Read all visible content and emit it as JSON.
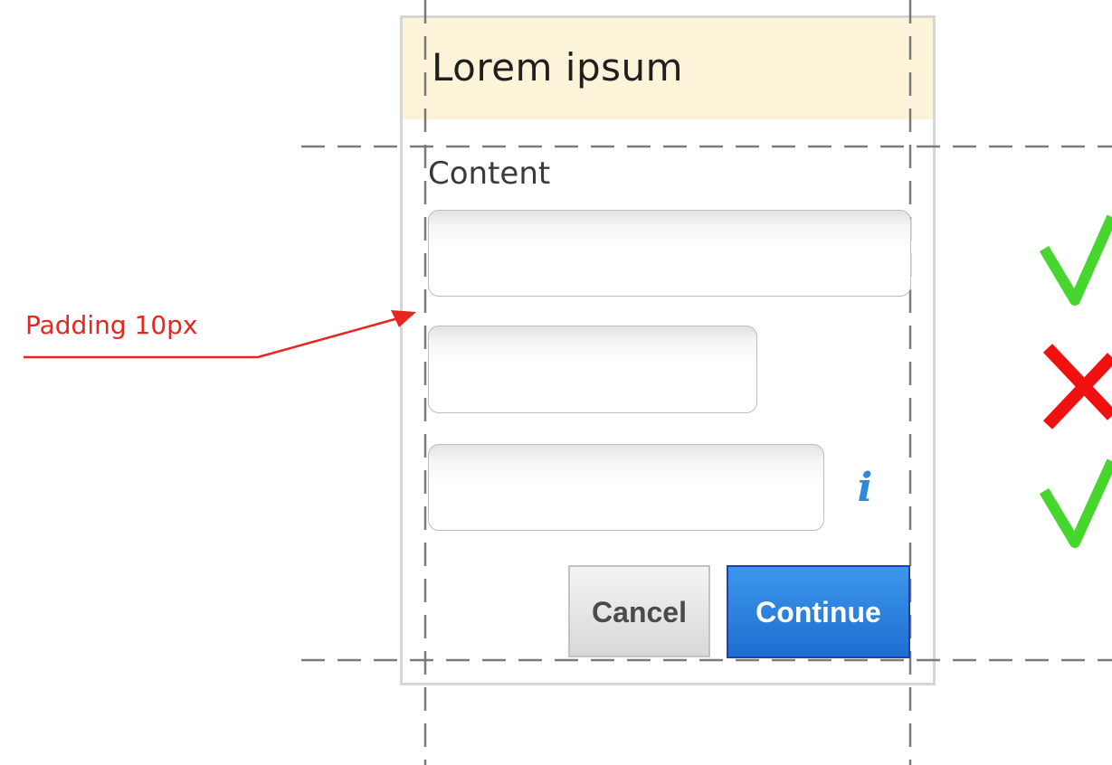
{
  "dialog": {
    "title": "Lorem ipsum",
    "content_label": "Content",
    "fields": [
      {
        "value": "",
        "placeholder": ""
      },
      {
        "value": "",
        "placeholder": ""
      },
      {
        "value": "",
        "placeholder": ""
      }
    ],
    "info_icon": {
      "glyph": "i",
      "icon": "info-icon",
      "color": "#2b8ad9"
    },
    "buttons": {
      "cancel_label": "Cancel",
      "continue_label": "Continue"
    }
  },
  "annotation": {
    "label": "Padding 10px",
    "color": "#e8261e"
  },
  "validation_marks": [
    {
      "icon": "check-icon",
      "color": "#47d62e"
    },
    {
      "icon": "cross-icon",
      "color": "#f01010"
    },
    {
      "icon": "check-icon",
      "color": "#47d62e"
    }
  ],
  "colors": {
    "header_background": "#fbf4d9",
    "primary_button": "#2a7ee0",
    "guide_line": "#7a7a7a"
  }
}
